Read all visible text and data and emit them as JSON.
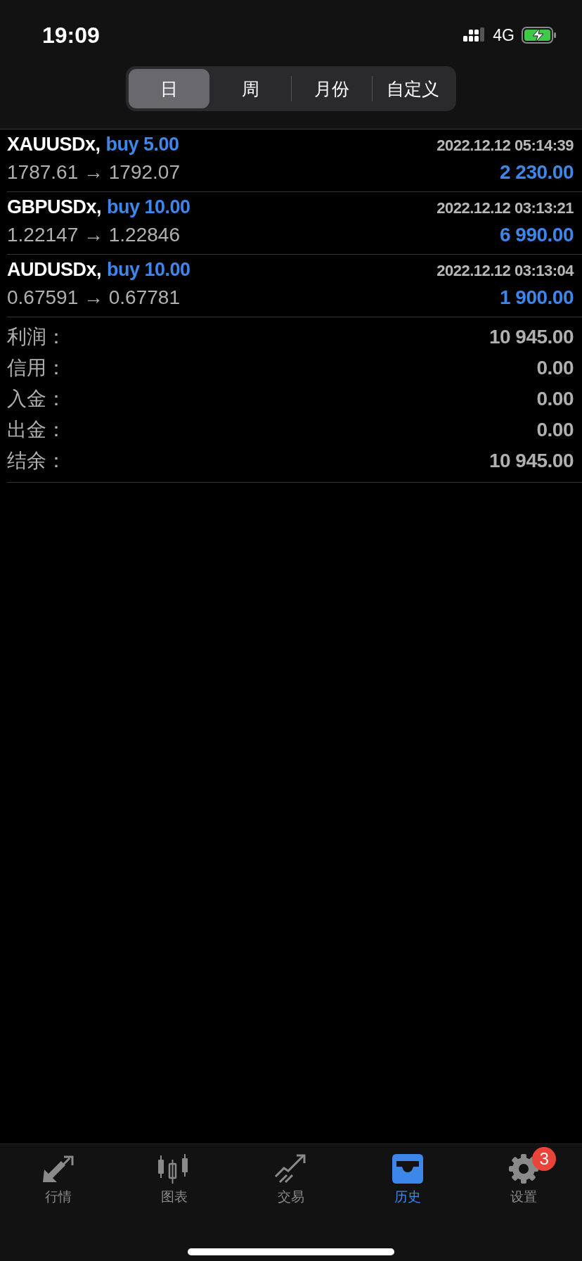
{
  "status_bar": {
    "time": "19:09",
    "network": "4G"
  },
  "segments": [
    {
      "label": "日",
      "selected": true
    },
    {
      "label": "周",
      "selected": false
    },
    {
      "label": "月份",
      "selected": false
    },
    {
      "label": "自定义",
      "selected": false
    }
  ],
  "deals": [
    {
      "symbol": "XAUUSDx,",
      "order": "buy 5.00",
      "time": "2022.12.12 05:14:39",
      "prices": "1787.61 → 1792.07",
      "profit": "2 230.00"
    },
    {
      "symbol": "GBPUSDx,",
      "order": "buy 10.00",
      "time": "2022.12.12 03:13:21",
      "prices": "1.22147 → 1.22846",
      "profit": "6 990.00"
    },
    {
      "symbol": "AUDUSDx,",
      "order": "buy 10.00",
      "time": "2022.12.12 03:13:04",
      "prices": "0.67591 → 0.67781",
      "profit": "1 900.00"
    }
  ],
  "summary": [
    {
      "label": "利润：",
      "value": "10 945.00"
    },
    {
      "label": "信用：",
      "value": "0.00"
    },
    {
      "label": "入金：",
      "value": "0.00"
    },
    {
      "label": "出金：",
      "value": "0.00"
    },
    {
      "label": "结余：",
      "value": "10 945.00"
    }
  ],
  "tab_bar": [
    {
      "label": "行情",
      "selected": false
    },
    {
      "label": "图表",
      "selected": false
    },
    {
      "label": "交易",
      "selected": false
    },
    {
      "label": "历史",
      "selected": true
    },
    {
      "label": "设置",
      "selected": false,
      "badge": "3"
    }
  ]
}
